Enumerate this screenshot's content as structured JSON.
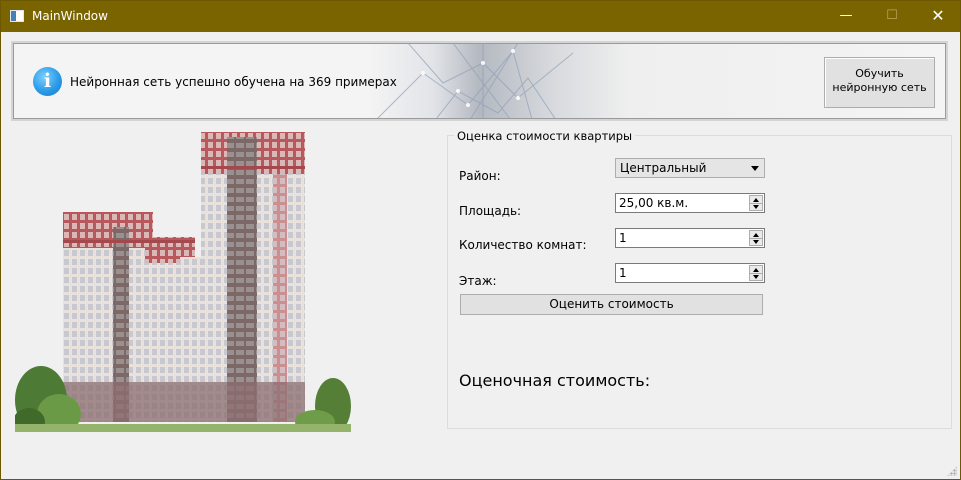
{
  "window": {
    "title": "MainWindow",
    "controls": {
      "minimize": "—",
      "maximize": "☐",
      "close": "✕"
    }
  },
  "banner": {
    "icon": "info-icon",
    "message": "Нейронная сеть успешно обучена на 369 примерах",
    "train_button_label": "Обучить\nнейронную сеть"
  },
  "form": {
    "group_title": "Оценка стоимости квартиры",
    "district": {
      "label": "Район:",
      "value": "Центральный"
    },
    "area": {
      "label": "Площадь:",
      "value": "25,00 кв.м."
    },
    "rooms": {
      "label": "Количество комнат:",
      "value": "1"
    },
    "floor": {
      "label": "Этаж:",
      "value": "1"
    },
    "evaluate_button_label": "Оценить стоимость",
    "result_label": "Оценочная стоимость:"
  },
  "colors": {
    "titlebar": "#7a6400",
    "window_bg": "#f0f0f0",
    "info_blue": "#1e8fe0",
    "building_red": "#a9454a"
  }
}
